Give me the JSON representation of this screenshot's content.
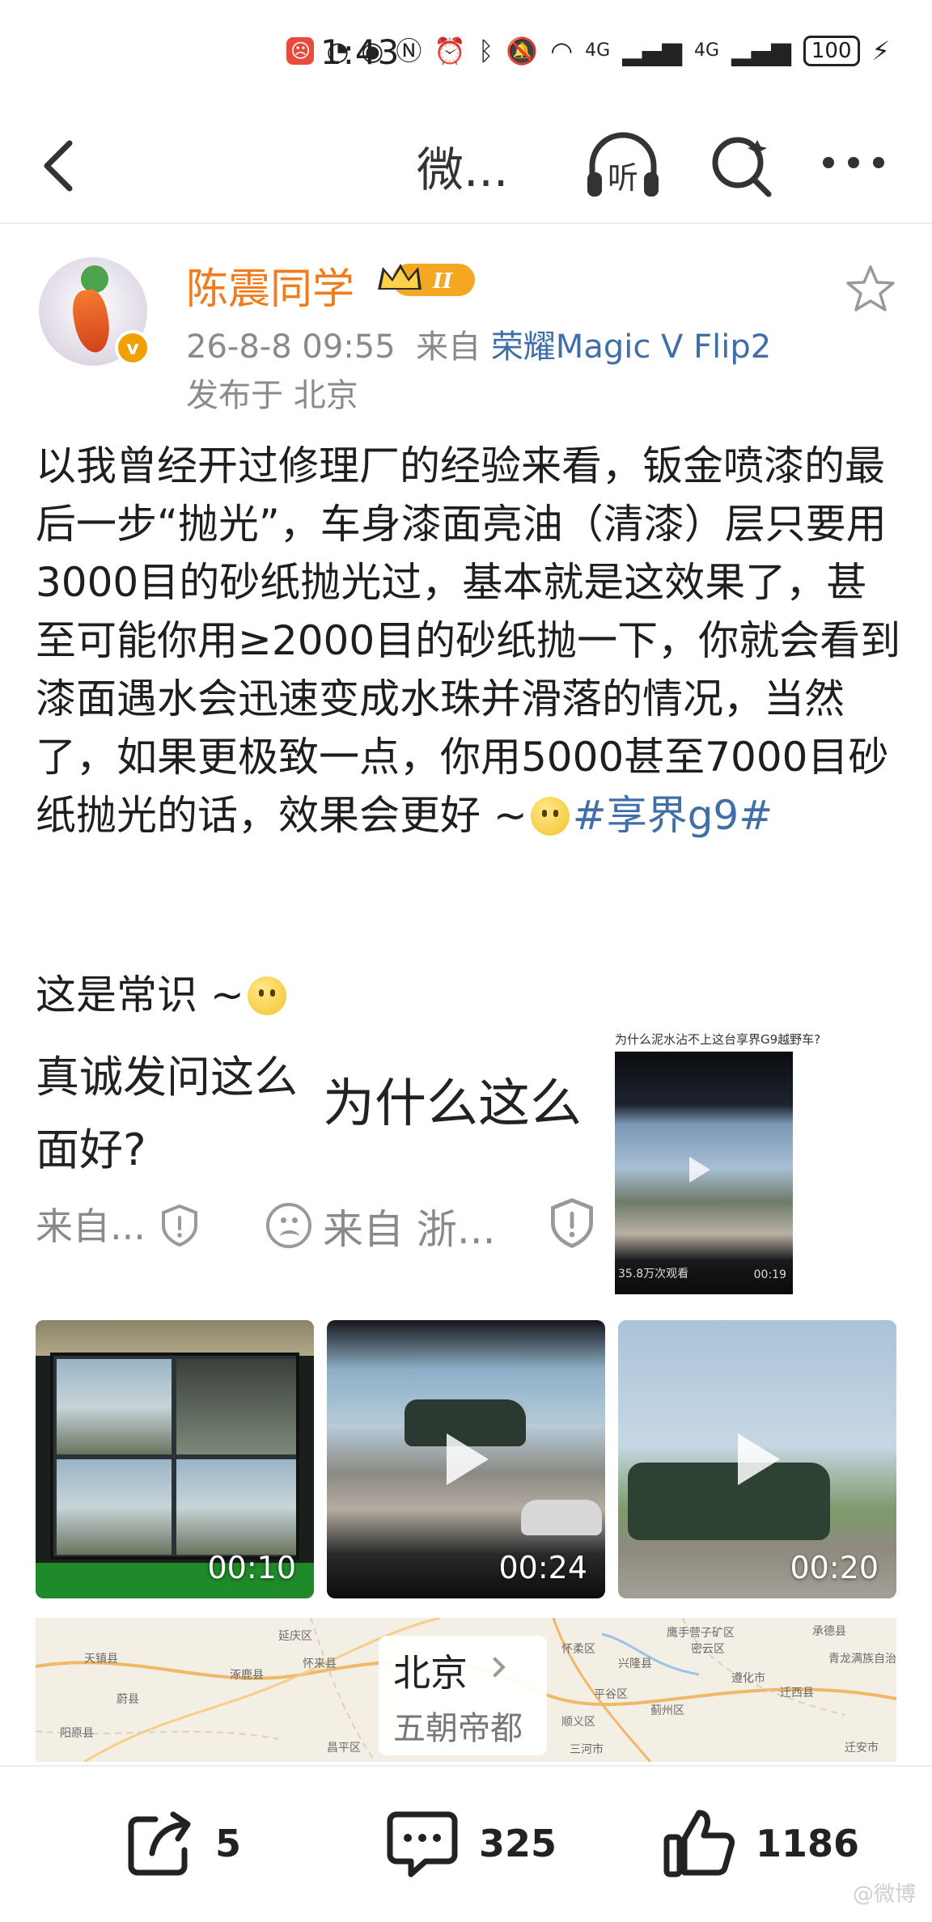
{
  "status_bar": {
    "time": "1:43",
    "battery": "100",
    "network_1": "4G",
    "network_2": "4G"
  },
  "nav": {
    "title": "微..."
  },
  "author": {
    "name": "陈震同学",
    "level_badge": "II",
    "verified_badge": "v",
    "timestamp": "26-8-8 09:55",
    "source_prefix": "来自",
    "device": "荣耀Magic V Flip2",
    "location": "发布于 北京"
  },
  "post": {
    "text": "以我曾经开过修理厂的经验来看，钣金喷漆的最后一步“抛光”，车身漆面亮油（清漆）层只要用3000目的砂纸抛光过，基本就是这效果了，甚至可能你用≥2000目的砂纸抛一下，你就会看到漆面遇水会迅速变成水珠并滑落的情况，当然了，如果更极致一点，你用5000甚至7000目砂纸抛光的话，效果会更好 ~",
    "hashtag": "#享界g9#",
    "text2": "这是常识 ~"
  },
  "collage": {
    "line1": "真诚发问这么",
    "line2": "面好?",
    "line3": "为什么这么",
    "from1": "来自...",
    "from2": "来自 浙...",
    "video_title": "为什么泥水沾不上这台享界G9越野车?",
    "video_views": "35.8万次观看",
    "video_duration": "00:19"
  },
  "thumbnails": [
    {
      "duration": "00:10"
    },
    {
      "duration": "00:24"
    },
    {
      "duration": "00:20"
    }
  ],
  "map": {
    "city": "北京",
    "description": "五朝帝都",
    "labels": [
      "天镇县",
      "阳原县",
      "蔚县",
      "涿鹿县",
      "怀来县",
      "延庆区",
      "昌平区",
      "顺义区",
      "平谷区",
      "蓟州区",
      "兴隆县",
      "遵化市",
      "迁西县",
      "承德县",
      "怀柔区",
      "密云区",
      "三河市",
      "青龙满族自治县",
      "迁安市",
      "鹰手营子矿区"
    ]
  },
  "actions": {
    "share_count": "5",
    "comment_count": "325",
    "like_count": "1186"
  },
  "watermark": "@微博"
}
